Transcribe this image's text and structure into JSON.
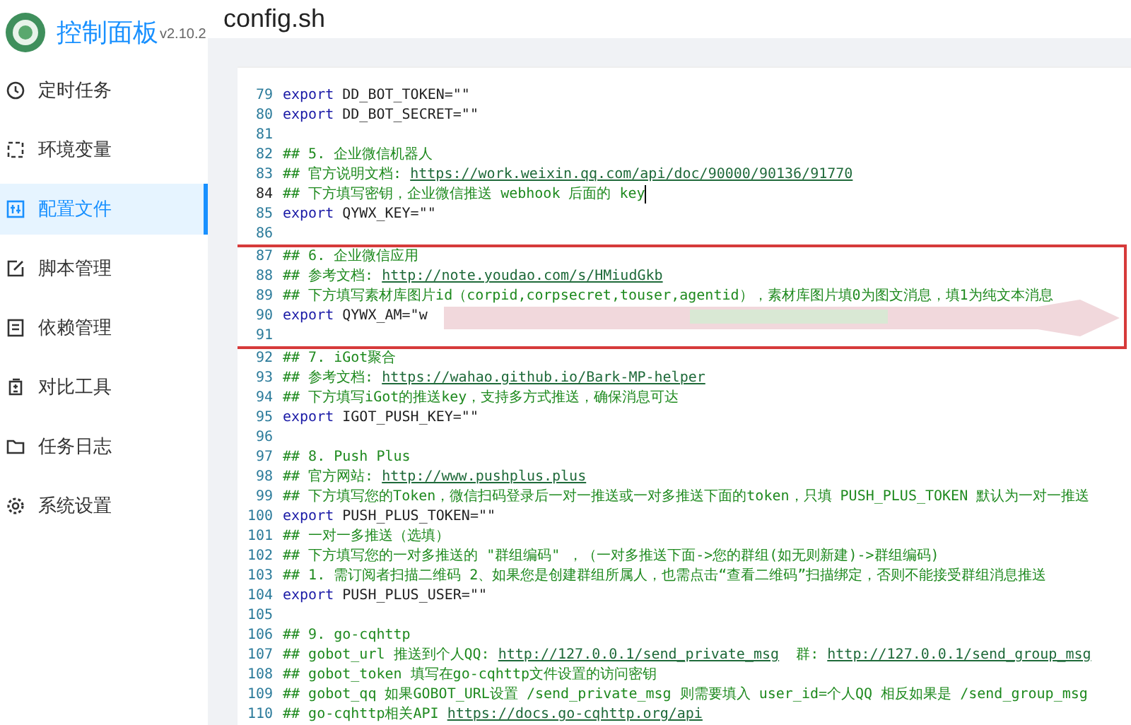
{
  "app": {
    "title": "控制面板",
    "version": "v2.10.2"
  },
  "sidebar": {
    "items": [
      {
        "label": "定时任务",
        "selected": false
      },
      {
        "label": "环境变量",
        "selected": false
      },
      {
        "label": "配置文件",
        "selected": true
      },
      {
        "label": "脚本管理",
        "selected": false
      },
      {
        "label": "依赖管理",
        "selected": false
      },
      {
        "label": "对比工具",
        "selected": false
      },
      {
        "label": "任务日志",
        "selected": false
      },
      {
        "label": "系统设置",
        "selected": false
      }
    ]
  },
  "page": {
    "title": "config.sh"
  },
  "editor": {
    "blocks": [
      {
        "highlighted": false,
        "lines": [
          {
            "number": "79",
            "active": false,
            "redacted": false,
            "segments": [
              {
                "kind": "keyword",
                "text": "export"
              },
              {
                "kind": "plain",
                "text": " DD_BOT_TOKEN=\"\""
              }
            ]
          },
          {
            "number": "80",
            "active": false,
            "redacted": false,
            "segments": [
              {
                "kind": "keyword",
                "text": "export"
              },
              {
                "kind": "plain",
                "text": " DD_BOT_SECRET=\"\""
              }
            ]
          },
          {
            "number": "81",
            "active": false,
            "redacted": false
          },
          {
            "number": "82",
            "active": false,
            "redacted": false,
            "segments": [
              {
                "kind": "comment",
                "text": "## 5. 企业微信机器人"
              }
            ]
          },
          {
            "number": "83",
            "active": false,
            "redacted": false,
            "segments": [
              {
                "kind": "comment",
                "text": "## 官方说明文档: "
              },
              {
                "kind": "link",
                "text": "https://work.weixin.qq.com/api/doc/90000/90136/91770"
              }
            ]
          },
          {
            "number": "84",
            "active": true,
            "redacted": false,
            "segments": [
              {
                "kind": "comment",
                "text": "## 下方填写密钥，企业微信推送 webhook 后面的 key"
              }
            ]
          },
          {
            "number": "85",
            "active": false,
            "redacted": false,
            "segments": [
              {
                "kind": "keyword",
                "text": "export"
              },
              {
                "kind": "plain",
                "text": " QYWX_KEY=\"\""
              }
            ]
          },
          {
            "number": "86",
            "active": false,
            "redacted": false
          }
        ]
      },
      {
        "highlighted": true,
        "lines": [
          {
            "number": "87",
            "active": false,
            "redacted": false,
            "segments": [
              {
                "kind": "comment",
                "text": "## 6. 企业微信应用"
              }
            ]
          },
          {
            "number": "88",
            "active": false,
            "redacted": false,
            "segments": [
              {
                "kind": "comment",
                "text": "## 参考文档: "
              },
              {
                "kind": "link",
                "text": "http://note.youdao.com/s/HMiudGkb"
              }
            ]
          },
          {
            "number": "89",
            "active": false,
            "redacted": false,
            "segments": [
              {
                "kind": "comment",
                "text": "## 下方填写素材库图片id（corpid,corpsecret,touser,agentid），素材库图片填0为图文消息，填1为纯文本消息"
              }
            ]
          },
          {
            "number": "90",
            "active": false,
            "redacted": true,
            "segments": [
              {
                "kind": "keyword",
                "text": "export"
              },
              {
                "kind": "plain",
                "text": " QYWX_AM=\"w"
              }
            ]
          },
          {
            "number": "91",
            "active": false,
            "redacted": false
          }
        ]
      },
      {
        "highlighted": false,
        "lines": [
          {
            "number": "92",
            "active": false,
            "redacted": false,
            "segments": [
              {
                "kind": "comment",
                "text": "## 7. iGot聚合"
              }
            ]
          },
          {
            "number": "93",
            "active": false,
            "redacted": false,
            "segments": [
              {
                "kind": "comment",
                "text": "## 参考文档: "
              },
              {
                "kind": "link",
                "text": "https://wahao.github.io/Bark-MP-helper"
              }
            ]
          },
          {
            "number": "94",
            "active": false,
            "redacted": false,
            "segments": [
              {
                "kind": "comment",
                "text": "## 下方填写iGot的推送key，支持多方式推送，确保消息可达"
              }
            ]
          },
          {
            "number": "95",
            "active": false,
            "redacted": false,
            "segments": [
              {
                "kind": "keyword",
                "text": "export"
              },
              {
                "kind": "plain",
                "text": " IGOT_PUSH_KEY=\"\""
              }
            ]
          },
          {
            "number": "96",
            "active": false,
            "redacted": false
          },
          {
            "number": "97",
            "active": false,
            "redacted": false,
            "segments": [
              {
                "kind": "comment",
                "text": "## 8. Push Plus"
              }
            ]
          },
          {
            "number": "98",
            "active": false,
            "redacted": false,
            "segments": [
              {
                "kind": "comment",
                "text": "## 官方网站: "
              },
              {
                "kind": "link",
                "text": "http://www.pushplus.plus"
              }
            ]
          },
          {
            "number": "99",
            "active": false,
            "redacted": false,
            "segments": [
              {
                "kind": "comment",
                "text": "## 下方填写您的Token，微信扫码登录后一对一推送或一对多推送下面的token，只填 PUSH_PLUS_TOKEN 默认为一对一推送"
              }
            ]
          },
          {
            "number": "100",
            "active": false,
            "redacted": false,
            "segments": [
              {
                "kind": "keyword",
                "text": "export"
              },
              {
                "kind": "plain",
                "text": " PUSH_PLUS_TOKEN=\"\""
              }
            ]
          },
          {
            "number": "101",
            "active": false,
            "redacted": false,
            "segments": [
              {
                "kind": "comment",
                "text": "## 一对一多推送（选填）"
              }
            ]
          },
          {
            "number": "102",
            "active": false,
            "redacted": false,
            "segments": [
              {
                "kind": "comment",
                "text": "## 下方填写您的一对多推送的 \"群组编码\" ，（一对多推送下面->您的群组(如无则新建)->群组编码)"
              }
            ]
          },
          {
            "number": "103",
            "active": false,
            "redacted": false,
            "segments": [
              {
                "kind": "comment",
                "text": "## 1. 需订阅者扫描二维码 2、如果您是创建群组所属人，也需点击“查看二维码”扫描绑定，否则不能接受群组消息推送"
              }
            ]
          },
          {
            "number": "104",
            "active": false,
            "redacted": false,
            "segments": [
              {
                "kind": "keyword",
                "text": "export"
              },
              {
                "kind": "plain",
                "text": " PUSH_PLUS_USER=\"\""
              }
            ]
          },
          {
            "number": "105",
            "active": false,
            "redacted": false
          },
          {
            "number": "106",
            "active": false,
            "redacted": false,
            "segments": [
              {
                "kind": "comment",
                "text": "## 9. go-cqhttp"
              }
            ]
          },
          {
            "number": "107",
            "active": false,
            "redacted": false,
            "segments": [
              {
                "kind": "comment",
                "text": "## gobot_url 推送到个人QQ: "
              },
              {
                "kind": "link",
                "text": "http://127.0.0.1/send_private_msg"
              },
              {
                "kind": "comment",
                "text": "  群: "
              },
              {
                "kind": "link",
                "text": "http://127.0.0.1/send_group_msg"
              }
            ]
          },
          {
            "number": "108",
            "active": false,
            "redacted": false,
            "segments": [
              {
                "kind": "comment",
                "text": "## gobot_token 填写在go-cqhttp文件设置的访问密钥"
              }
            ]
          },
          {
            "number": "109",
            "active": false,
            "redacted": false,
            "segments": [
              {
                "kind": "comment",
                "text": "## gobot_qq 如果GOBOT_URL设置 /send_private_msg 则需要填入 user_id=个人QQ 相反如果是 /send_group_msg"
              }
            ]
          },
          {
            "number": "110",
            "active": false,
            "redacted": false,
            "segments": [
              {
                "kind": "comment",
                "text": "## go-cqhttp相关API "
              },
              {
                "kind": "link",
                "text": "https://docs.go-cqhttp.org/api"
              }
            ]
          }
        ]
      }
    ]
  }
}
